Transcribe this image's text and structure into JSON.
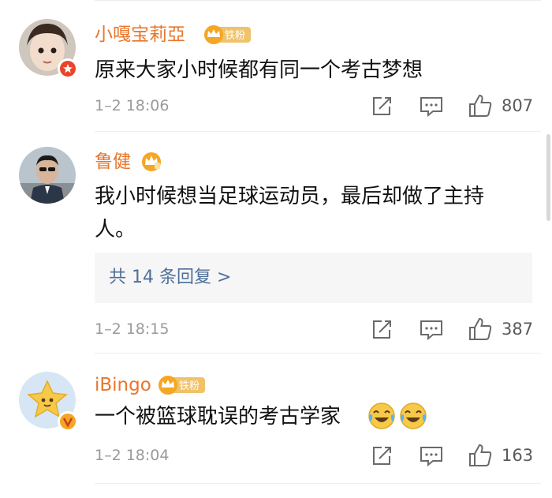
{
  "comments": [
    {
      "username": "小嘎宝莉亞",
      "fan_badge": "铁粉",
      "text": "原来大家小时候都有同一个考古梦想",
      "time": "1–2 18:06",
      "likes": "807"
    },
    {
      "username": "鲁健",
      "text_line1": "我小时候想当足球运动员，最后却做了主持",
      "text_line2": "人。",
      "replies_label": "共 14 条回复 >",
      "time": "1–2 18:15",
      "likes": "387"
    },
    {
      "username": "iBingo",
      "fan_badge": "铁粉",
      "text": "一个被篮球耽误的考古学家",
      "emoji": [
        "laughing-crying-emoji",
        "laughing-crying-emoji"
      ],
      "time": "1–2 18:04",
      "likes": "163"
    }
  ],
  "colors": {
    "username": "#e8762c",
    "reply_link": "#4e6f9a",
    "meta": "#9a9a9a",
    "crown": "#f5a623",
    "verify_red": "#e8452c"
  }
}
